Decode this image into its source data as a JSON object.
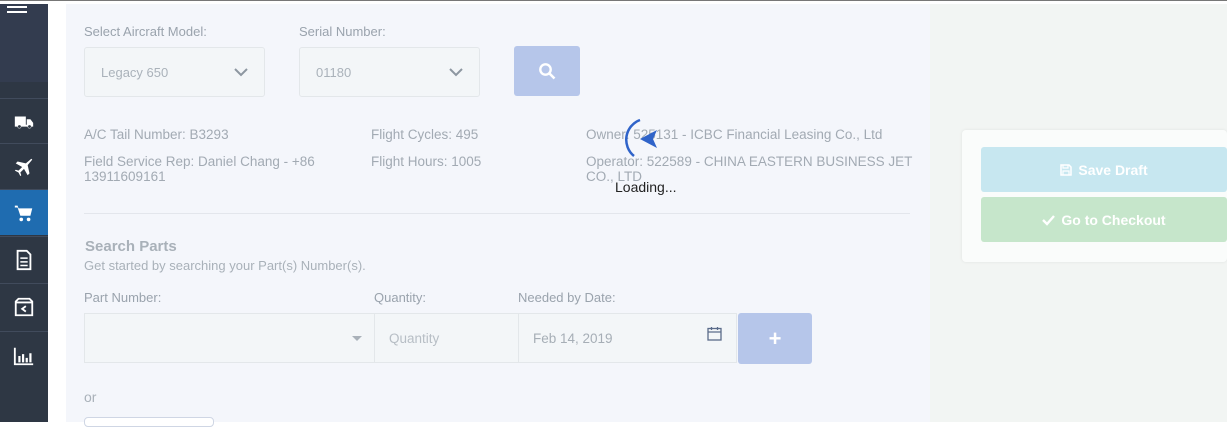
{
  "sidebar": {
    "items": [
      {
        "icon": "truck-icon"
      },
      {
        "icon": "plane-icon"
      },
      {
        "icon": "cart-icon",
        "active": true
      },
      {
        "icon": "document-icon"
      },
      {
        "icon": "package-return-icon"
      },
      {
        "icon": "bar-chart-icon"
      }
    ]
  },
  "aircraft": {
    "model_label": "Select Aircraft Model:",
    "model_value": "Legacy 650",
    "serial_label": "Serial Number:",
    "serial_value": "01180"
  },
  "info": {
    "tail": "A/C Tail Number: B3293",
    "rep": "Field Service Rep: Daniel Chang - +86 13911609161",
    "cycles": "Flight Cycles: 495",
    "hours": "Flight Hours: 1005",
    "owner": "Owner: 525131 - ICBC Financial Leasing Co., Ltd",
    "operator": "Operator: 522589 - CHINA EASTERN BUSINESS JET CO., LTD"
  },
  "search_parts": {
    "title": "Search Parts",
    "subtitle": "Get started by searching your Part(s) Number(s).",
    "part_label": "Part Number:",
    "qty_label": "Quantity:",
    "date_label": "Needed by Date:",
    "qty_placeholder": "Quantity",
    "date_value": "Feb 14, 2019",
    "add_label": "+",
    "or_text": "or"
  },
  "actions": {
    "save_draft": "Save Draft",
    "checkout": "Go to Checkout"
  },
  "loading_text": "Loading..."
}
